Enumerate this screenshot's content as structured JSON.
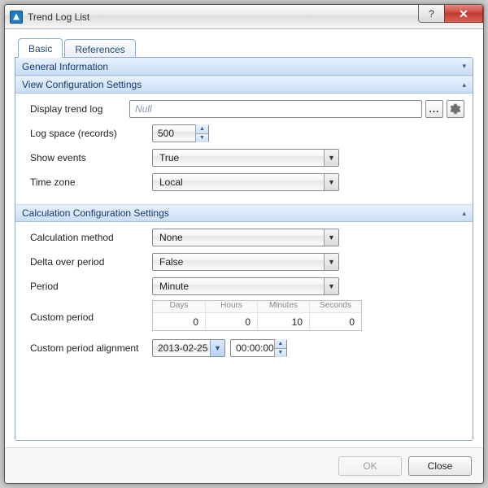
{
  "window": {
    "title": "Trend Log List"
  },
  "tabs": {
    "basic": "Basic",
    "references": "References"
  },
  "sections": {
    "general": "General Information",
    "view": "View Configuration Settings",
    "calc": "Calculation Configuration Settings"
  },
  "view": {
    "display_trend_log_label": "Display trend log",
    "display_trend_log_value": "Null",
    "log_space_label": "Log space (records)",
    "log_space_value": "500",
    "show_events_label": "Show events",
    "show_events_value": "True",
    "time_zone_label": "Time zone",
    "time_zone_value": "Local"
  },
  "calc": {
    "method_label": "Calculation method",
    "method_value": "None",
    "delta_label": "Delta over period",
    "delta_value": "False",
    "period_label": "Period",
    "period_value": "Minute",
    "custom_period_label": "Custom period",
    "cp_headers": {
      "days": "Days",
      "hours": "Hours",
      "minutes": "Minutes",
      "seconds": "Seconds"
    },
    "cp_values": {
      "days": "0",
      "hours": "0",
      "minutes": "10",
      "seconds": "0"
    },
    "alignment_label": "Custom period alignment",
    "alignment_date": "2013-02-25",
    "alignment_time": "00:00:00"
  },
  "footer": {
    "ok": "OK",
    "close": "Close"
  },
  "glyphs": {
    "help": "?",
    "close": "✕",
    "up": "▲",
    "down": "▼",
    "dot": "...",
    "collapsed": "▾",
    "expanded": "▴"
  }
}
